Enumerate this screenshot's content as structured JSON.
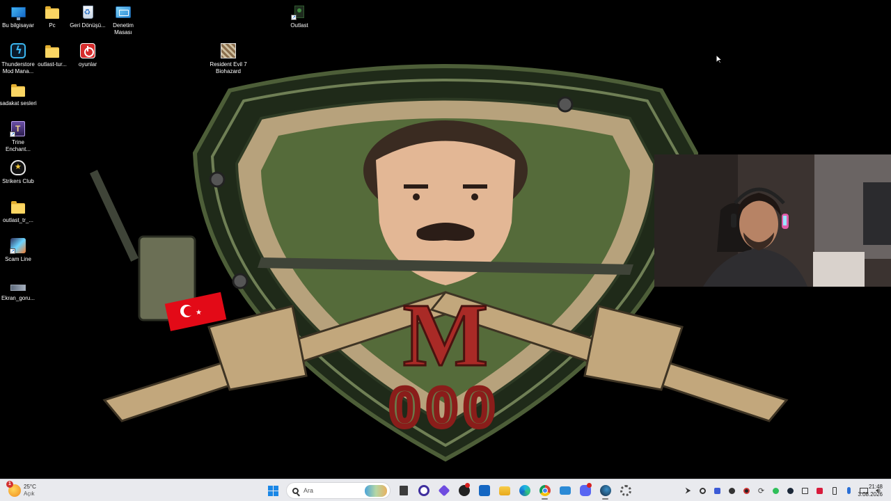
{
  "desktop": {
    "icons": [
      {
        "label": "Bu bilgisayar",
        "icon": "this-pc-icon"
      },
      {
        "label": "Pc",
        "icon": "folder-icon"
      },
      {
        "label": "Geri Dönüşü...",
        "icon": "recycle-bin-icon"
      },
      {
        "label": "Denetim Masası",
        "icon": "control-panel-icon"
      },
      {
        "label": "Outlast",
        "icon": "outlast-game-icon"
      },
      {
        "label": "Thunderstore Mod Mana...",
        "icon": "thunderstore-icon"
      },
      {
        "label": "outlast-tur...",
        "icon": "folder-icon"
      },
      {
        "label": "oyunlar",
        "icon": "power-shortcut-icon"
      },
      {
        "label": "Resident Evil 7 Biohazard",
        "icon": "resident-evil-icon"
      },
      {
        "label": "sadakat sesleri",
        "icon": "folder-icon"
      },
      {
        "label": "Trine Enchant...",
        "icon": "trine-game-icon"
      },
      {
        "label": "Strikers Club",
        "icon": "strikers-club-icon"
      },
      {
        "label": "outlast_tr_...",
        "icon": "folder-icon"
      },
      {
        "label": "Scam Line",
        "icon": "scam-line-game-icon"
      },
      {
        "label": "Ekran_goru...",
        "icon": "screenshot-file-icon"
      }
    ]
  },
  "wallpaper": {
    "emblem_letter": "M",
    "emblem_number": "000",
    "colors": {
      "shield_outer": "#2d3a24",
      "shield_inner": "#556b3a",
      "camo": "#b7a27c",
      "letter": "#a92a26",
      "rifle": "#c2a77c"
    }
  },
  "taskbar": {
    "weather": {
      "temp": "25°C",
      "condition": "Açık",
      "badge": "1"
    },
    "search_placeholder": "Ara",
    "apps": [
      {
        "name": "start-button",
        "label": "Başlat"
      },
      {
        "name": "file-manager-icon"
      },
      {
        "name": "cortana-ring-icon"
      },
      {
        "name": "blue-diamond-app-icon"
      },
      {
        "name": "github-desktop-icon"
      },
      {
        "name": "store-app-icon"
      },
      {
        "name": "file-explorer-icon"
      },
      {
        "name": "edge-browser-icon"
      },
      {
        "name": "chrome-browser-icon"
      },
      {
        "name": "camera-app-icon"
      },
      {
        "name": "discord-icon"
      },
      {
        "name": "steam-icon"
      },
      {
        "name": "settings-gear-icon"
      }
    ],
    "tray_icons": [
      "arrow-icon",
      "browser-ring-icon",
      "shield-icon",
      "record-icon",
      "refresh-icon",
      "green-dot-icon",
      "steam-tray-icon",
      "square-icon",
      "red-app-icon",
      "battery-icon",
      "mic-icon",
      "display-icon",
      "volume-icon"
    ],
    "clock": {
      "time": "21:48",
      "date": "3.08.2026"
    },
    "colors": {
      "bar": "#e9eaee",
      "accent": "#1a87e6"
    }
  }
}
